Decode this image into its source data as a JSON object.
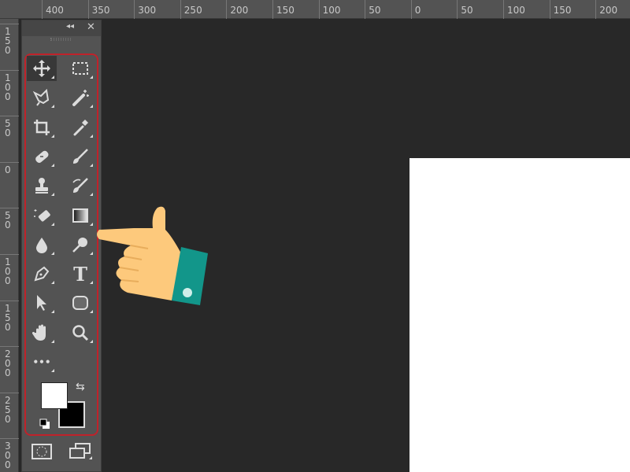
{
  "ruler_top": {
    "labels": [
      "400",
      "350",
      "300",
      "250",
      "200",
      "150",
      "100",
      "50",
      "0",
      "50",
      "100",
      "150",
      "200"
    ]
  },
  "ruler_left": {
    "labels": [
      "150",
      "100",
      "50",
      "0",
      "50",
      "100",
      "150",
      "200",
      "250",
      "300"
    ]
  },
  "toolbar": {
    "collapse_label": "◂◂",
    "close_label": "✕",
    "tools": [
      {
        "name": "move-tool",
        "icon": "move-icon"
      },
      {
        "name": "marquee-tool",
        "icon": "rect-marquee-icon"
      },
      {
        "name": "lasso-tool",
        "icon": "polygonal-lasso-icon"
      },
      {
        "name": "magic-wand-tool",
        "icon": "magic-wand-icon"
      },
      {
        "name": "crop-tool",
        "icon": "crop-icon"
      },
      {
        "name": "eyedropper-tool",
        "icon": "eyedropper-icon"
      },
      {
        "name": "healing-brush-tool",
        "icon": "bandage-icon"
      },
      {
        "name": "brush-tool",
        "icon": "brush-icon"
      },
      {
        "name": "clone-stamp-tool",
        "icon": "stamp-icon"
      },
      {
        "name": "history-brush-tool",
        "icon": "history-brush-icon"
      },
      {
        "name": "eraser-tool",
        "icon": "eraser-icon"
      },
      {
        "name": "gradient-tool",
        "icon": "gradient-icon"
      },
      {
        "name": "blur-tool",
        "icon": "drop-icon"
      },
      {
        "name": "dodge-tool",
        "icon": "dodge-icon"
      },
      {
        "name": "pen-tool",
        "icon": "pen-icon"
      },
      {
        "name": "type-tool",
        "icon": "type-icon"
      },
      {
        "name": "path-selection-tool",
        "icon": "arrow-icon"
      },
      {
        "name": "shape-tool",
        "icon": "rounded-rect-icon"
      },
      {
        "name": "hand-tool",
        "icon": "hand-icon"
      },
      {
        "name": "zoom-tool",
        "icon": "magnifier-icon"
      },
      {
        "name": "edit-toolbar",
        "icon": "more-icon"
      }
    ],
    "type_glyph": "T",
    "more_glyph": "•••",
    "swap_glyph": "⇆",
    "foreground_color": "#ffffff",
    "background_color": "#000000"
  },
  "colors": {
    "highlight": "#c0222a",
    "hand_skin": "#fdc97c",
    "cuff": "#12968a"
  }
}
